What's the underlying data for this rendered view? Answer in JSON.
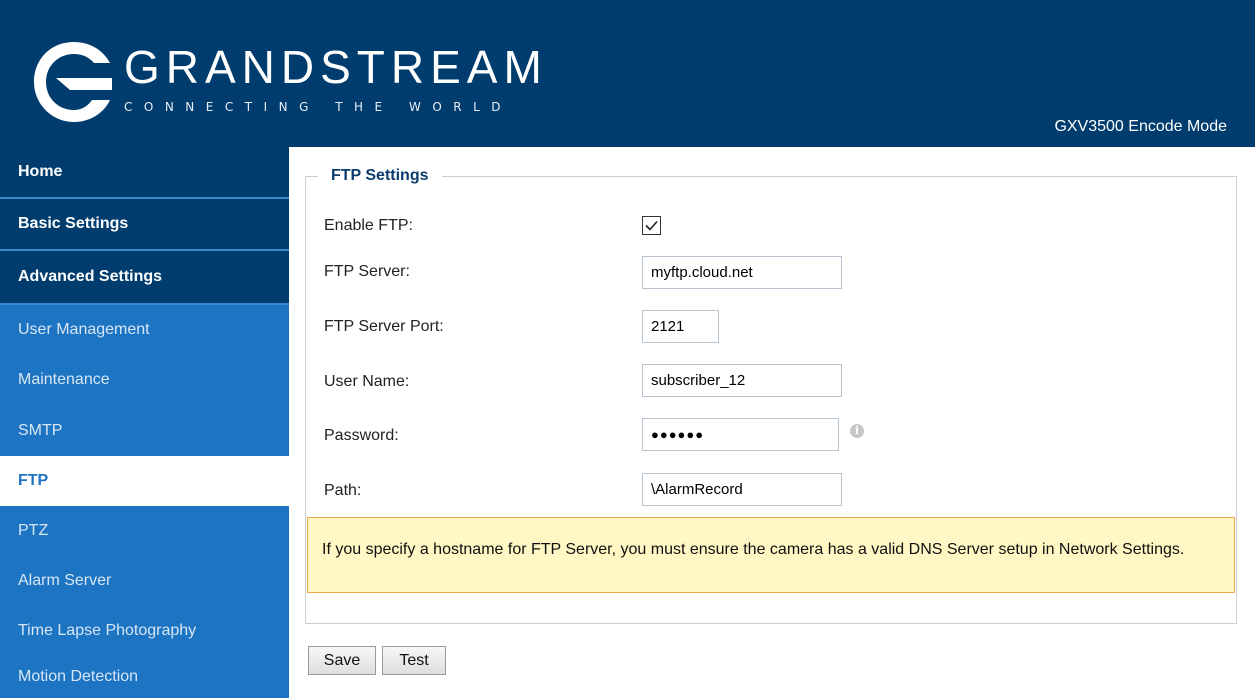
{
  "header": {
    "brand": "GRANDSTREAM",
    "tagline": "CONNECTING THE WORLD",
    "model": "GXV3500 Encode Mode",
    "colors": {
      "header_bg": "#003d6e",
      "sidebar_bg": "#1d74c2"
    }
  },
  "sidebar": {
    "top_items": [
      {
        "label": "Home"
      },
      {
        "label": "Basic Settings"
      },
      {
        "label": "Advanced Settings"
      }
    ],
    "sub_items": [
      {
        "label": "User Management"
      },
      {
        "label": "Maintenance"
      },
      {
        "label": "SMTP"
      },
      {
        "label": "FTP",
        "active": true
      },
      {
        "label": "PTZ"
      },
      {
        "label": "Alarm Server"
      },
      {
        "label": "Time Lapse Photography"
      },
      {
        "label": "Motion Detection"
      }
    ]
  },
  "ftp": {
    "legend": "FTP Settings",
    "enable_label": "Enable FTP:",
    "enable_checked": true,
    "server_label": "FTP Server:",
    "server_value": "myftp.cloud.net",
    "port_label": "FTP Server Port:",
    "port_value": "2121",
    "username_label": "User Name:",
    "username_value": "subscriber_12",
    "password_label": "Password:",
    "password_mask": "●●●●●●",
    "info_icon": "info-icon",
    "path_label": "Path:",
    "path_value": "\\AlarmRecord",
    "notice": "If you specify a hostname for FTP Server, you must ensure the camera has a valid DNS Server setup in Network Settings."
  },
  "buttons": {
    "save": "Save",
    "test": "Test"
  }
}
